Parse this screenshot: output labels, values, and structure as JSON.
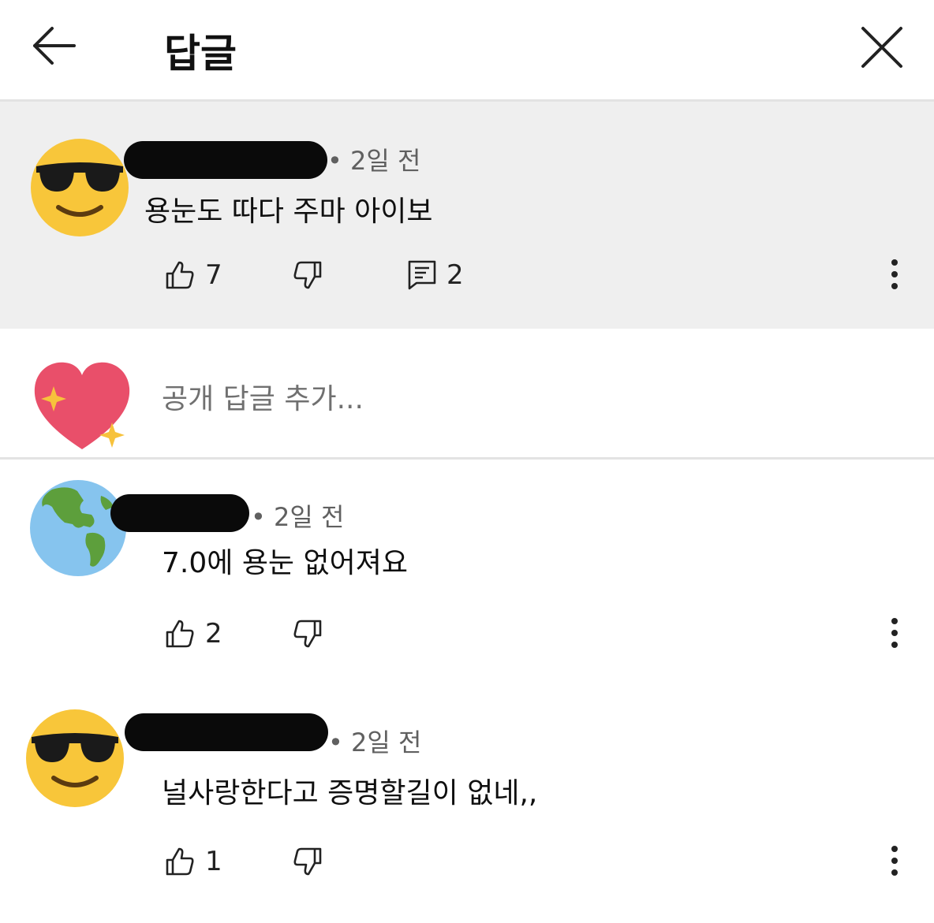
{
  "header": {
    "title": "답글",
    "back_icon": "arrow-left-icon",
    "close_icon": "close-icon"
  },
  "comments": [
    {
      "avatar_icon": "sunglasses-emoji-icon",
      "author_redacted": true,
      "time": "• 2일 전",
      "text": "용눈도 따다 주마 아이보",
      "likes": "7",
      "replies": "2"
    },
    {
      "avatar_icon": "earth-globe-emoji-icon",
      "author_redacted": true,
      "time": "• 2일 전",
      "text": "7.0에 용눈 없어져요",
      "likes": "2"
    },
    {
      "avatar_icon": "sunglasses-emoji-icon",
      "author_redacted": true,
      "time": "• 2일 전",
      "text": "널사랑한다고 증명할길이 없네,,",
      "likes": "1"
    }
  ],
  "reply_box": {
    "avatar_icon": "sparkling-heart-emoji-icon",
    "placeholder": "공개 답글 추가..."
  },
  "colors": {
    "highlight_bg": "#efefef",
    "divider": "#e3e3e3",
    "muted_text": "#606060"
  }
}
